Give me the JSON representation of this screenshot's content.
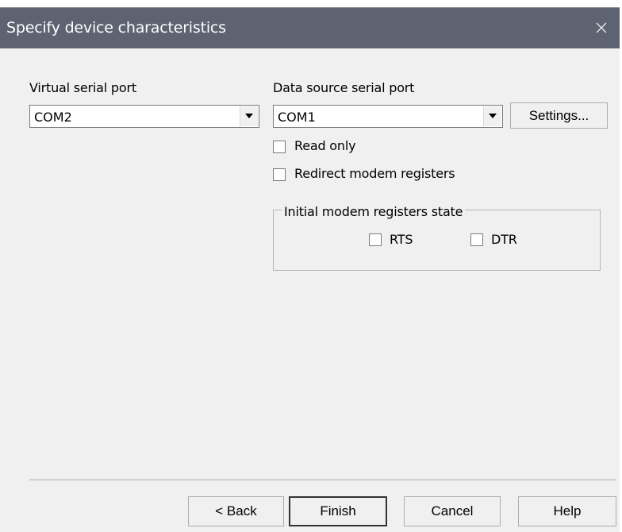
{
  "dialog": {
    "title": "Specify device characteristics",
    "close_icon": "close-icon"
  },
  "virtual_port": {
    "label": "Virtual serial port",
    "value": "COM2",
    "arrow_icon": "dropdown-arrow-icon"
  },
  "source_port": {
    "label": "Data source serial port",
    "value": "COM1",
    "arrow_icon": "dropdown-arrow-icon",
    "settings_label": "Settings..."
  },
  "options": {
    "read_only": {
      "label": "Read only",
      "checked": false
    },
    "redirect_modem": {
      "label": "Redirect modem registers",
      "checked": false
    }
  },
  "modem_group": {
    "title": "Initial modem registers state",
    "rts": {
      "label": "RTS",
      "checked": false
    },
    "dtr": {
      "label": "DTR",
      "checked": false
    }
  },
  "footer": {
    "back_label": "< Back",
    "finish_label": "Finish",
    "cancel_label": "Cancel",
    "help_label": "Help"
  },
  "colors": {
    "titlebar": "#5d6371",
    "dialog_bg": "#f0f0f0",
    "button_border": "#adadad",
    "default_button_border": "#333333"
  }
}
